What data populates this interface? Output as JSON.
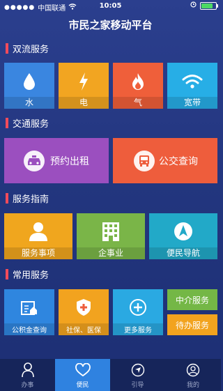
{
  "status_bar": {
    "carrier": "中国联通",
    "time": "10:05"
  },
  "header": {
    "title": "市民之家移动平台"
  },
  "sections": {
    "shuangliu": {
      "title": "双流服务"
    },
    "traffic": {
      "title": "交通服务"
    },
    "guide": {
      "title": "服务指南"
    },
    "common": {
      "title": "常用服务"
    }
  },
  "tiles": {
    "water": {
      "label": "水",
      "icon": "water-drop-icon",
      "color": "#3a86e0"
    },
    "electricity": {
      "label": "电",
      "icon": "lightning-icon",
      "color": "#f2a521"
    },
    "gas": {
      "label": "气",
      "icon": "flame-icon",
      "color": "#ef5f3a"
    },
    "broadband": {
      "label": "宽带",
      "icon": "wifi-icon",
      "color": "#27aee6"
    },
    "taxi": {
      "label": "预约出租",
      "icon": "taxi-icon",
      "color": "#9b4fbf"
    },
    "bus": {
      "label": "公交查询",
      "icon": "bus-icon",
      "color": "#ee5d3c"
    },
    "affairs": {
      "label": "服务事项",
      "icon": "person-icon",
      "color": "#f0a61e"
    },
    "enterprise": {
      "label": "企事业",
      "icon": "building-icon",
      "color": "#7ab548"
    },
    "navigation": {
      "label": "便民导航",
      "icon": "navigation-icon",
      "color": "#22a9c8"
    },
    "fund": {
      "label": "公积金查询",
      "icon": "housing-fund-icon",
      "color": "#2f86df"
    },
    "insurance": {
      "label": "社保、医保",
      "icon": "medical-shield-icon",
      "color": "#f2a31f"
    },
    "more": {
      "label": "更多服务",
      "icon": "plus-circle-icon",
      "color": "#2aa9e2"
    },
    "agency": {
      "label": "中介服务",
      "color": "#74b746"
    },
    "pending": {
      "label": "待办服务",
      "color": "#f2a31e"
    }
  },
  "tabbar": {
    "items": [
      {
        "label": "办事",
        "icon": "person-icon"
      },
      {
        "label": "便民",
        "icon": "heart-icon"
      },
      {
        "label": "引导",
        "icon": "navigation-icon"
      },
      {
        "label": "我的",
        "icon": "user-icon"
      }
    ],
    "active_index": 1,
    "active_color": "#2f82e0"
  },
  "battery_level": 0.9
}
